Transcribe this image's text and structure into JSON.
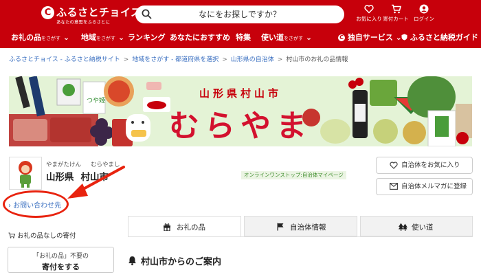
{
  "header": {
    "logo_text": "ふるさとチョイス",
    "logo_tagline": "あなたの意思をふるさとに",
    "search_placeholder": "なにをお探しですか？",
    "favorites_label": "お気に入り",
    "cart_label": "寄付カート",
    "login_label": "ログイン"
  },
  "nav": {
    "items": [
      {
        "label": "お礼の品",
        "suffix": "をさがす"
      },
      {
        "label": "地域",
        "suffix": "をさがす"
      },
      {
        "label": "ランキング",
        "suffix": ""
      },
      {
        "label": "あなたにおすすめ",
        "suffix": ""
      },
      {
        "label": "特集",
        "suffix": ""
      },
      {
        "label": "使い道",
        "suffix": "をさがす"
      },
      {
        "label": "独自サービス",
        "suffix": ""
      },
      {
        "label": "ふるさと納税ガイド",
        "suffix": ""
      }
    ]
  },
  "breadcrumb": {
    "items": [
      "ふるさとチョイス - ふるさと納税サイト",
      "地域をさがす - 都道府県を選択",
      "山形県の自治体",
      "村山市のお礼の品情報"
    ]
  },
  "banner": {
    "title": "山形県村山市",
    "big_text": "むらやま"
  },
  "municipality": {
    "kana_pref": "やまがたけん",
    "kana_city": "むらやまし",
    "pref": "山形県",
    "city": "村山市",
    "badge": "オンラインワンストップ:自治体マイページ"
  },
  "actions": {
    "favorite_label": "自治体をお気に入り",
    "newsletter_label": "自治体メルマガに登録"
  },
  "sidebar": {
    "contact_label": "› お問い合わせ先",
    "no_gift_label": "お礼の品なしの寄付",
    "gift_button_line1": "「お礼の品」不要の",
    "gift_button_line2": "寄付をする"
  },
  "tabs": [
    {
      "label": "お礼の品"
    },
    {
      "label": "自治体情報"
    },
    {
      "label": "使い道"
    }
  ],
  "notice": {
    "title": "村山市からのご案内"
  },
  "colors": {
    "brand": "#c7000b",
    "annotation": "#e8230f"
  }
}
